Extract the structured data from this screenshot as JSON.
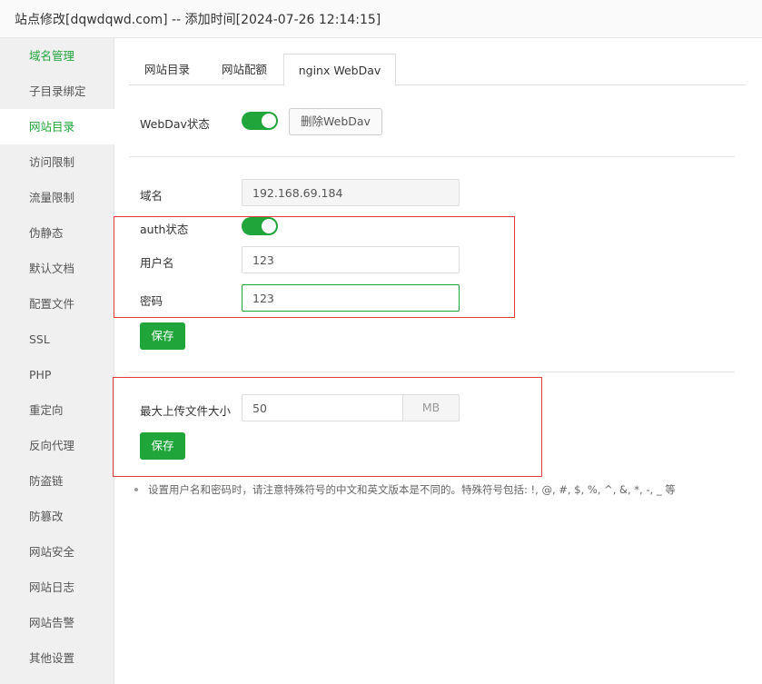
{
  "window": {
    "title": "站点修改[dqwdqwd.com] -- 添加时间[2024-07-26 12:14:15]"
  },
  "colors": {
    "accent": "#20a53a",
    "highlight_box": "#e03c3c",
    "sidebar_bg": "#f0f0f0"
  },
  "sidebar": {
    "items": [
      {
        "label": "域名管理"
      },
      {
        "label": "子目录绑定"
      },
      {
        "label": "网站目录"
      },
      {
        "label": "访问限制"
      },
      {
        "label": "流量限制"
      },
      {
        "label": "伪静态"
      },
      {
        "label": "默认文档"
      },
      {
        "label": "配置文件"
      },
      {
        "label": "SSL"
      },
      {
        "label": "PHP"
      },
      {
        "label": "重定向"
      },
      {
        "label": "反向代理"
      },
      {
        "label": "防盗链"
      },
      {
        "label": "防篡改"
      },
      {
        "label": "网站安全"
      },
      {
        "label": "网站日志"
      },
      {
        "label": "网站告警"
      },
      {
        "label": "其他设置"
      }
    ],
    "active_label": "网站目录"
  },
  "tabs": [
    {
      "label": "网站目录"
    },
    {
      "label": "网站配额"
    },
    {
      "label": "nginx WebDav"
    }
  ],
  "active_tab": "nginx WebDav",
  "webdav": {
    "status_label": "WebDav状态",
    "status_on": true,
    "delete_button": "删除WebDav"
  },
  "form": {
    "domain_label": "域名",
    "domain_value": "192.168.69.184",
    "auth_label": "auth状态",
    "auth_on": true,
    "username_label": "用户名",
    "username_value": "123",
    "password_label": "密码",
    "password_value": "123",
    "save_button": "保存"
  },
  "upload": {
    "label": "最大上传文件大小",
    "value": "50",
    "unit": "MB",
    "save_button": "保存"
  },
  "note": {
    "text": "设置用户名和密码时，请注意特殊符号的中文和英文版本是不同的。特殊符号包括: !, @, #, $, %, ^, &, *, -, _ 等"
  }
}
